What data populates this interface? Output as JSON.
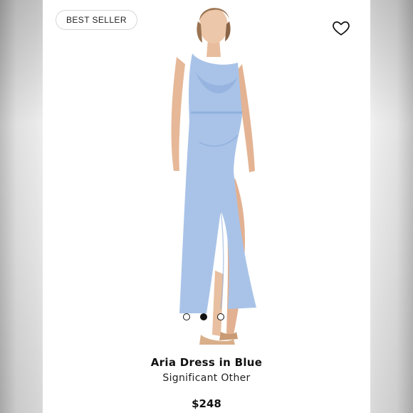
{
  "badge": {
    "label": "BEST SELLER"
  },
  "product": {
    "name": "Aria Dress in Blue",
    "brand": "Significant Other",
    "price": "$248"
  },
  "carousel": {
    "total": 3,
    "active": 2
  },
  "icons": {
    "favorite": "heart-outline-icon"
  },
  "colors": {
    "dress": "#a9c3e8",
    "text": "#111111",
    "badge_border": "#d6d6d6"
  }
}
